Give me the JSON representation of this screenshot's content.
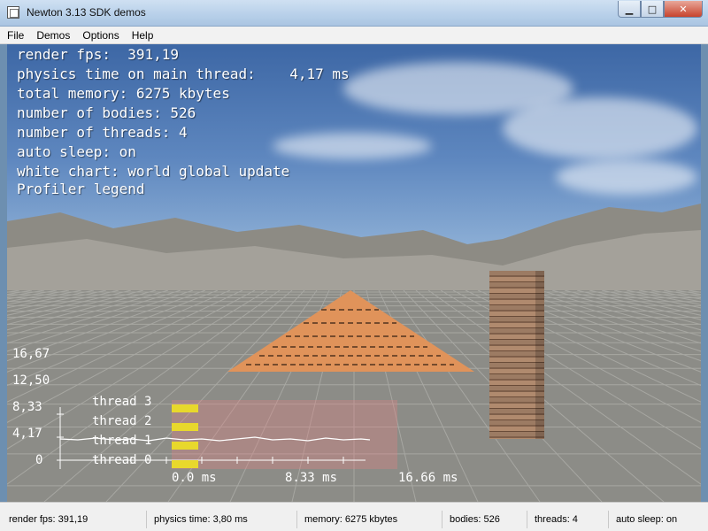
{
  "window": {
    "title": "Newton 3.13 SDK demos",
    "icons": {
      "app": "app-window-icon",
      "minimize": "minimize-icon",
      "maximize": "maximize-icon",
      "close": "close-icon"
    },
    "minimize_glyph": "▁",
    "maximize_glyph": "□",
    "close_glyph": "✕"
  },
  "menubar": {
    "items": [
      "File",
      "Demos",
      "Options",
      "Help"
    ]
  },
  "overlay": {
    "lines": [
      "render fps:  391,19",
      "physics time on main thread:    4,17 ms",
      "total memory: 6275 kbytes",
      "number of bodies: 526",
      "number of threads: 4",
      "auto sleep: on",
      "white chart: world global update",
      "Profiler legend"
    ]
  },
  "profiler": {
    "y_labels": [
      "16,67",
      "12,50",
      "8,33",
      "4,17",
      "0"
    ],
    "threads": [
      "thread 3",
      "thread 2",
      "thread 1",
      "thread 0"
    ],
    "x_labels": [
      "0.0 ms",
      "8.33 ms",
      "16.66 ms"
    ],
    "thread_color": "#e8d82c",
    "panel_color": "#e08080"
  },
  "statusbar": {
    "fps": "render fps: 391,19",
    "physics": "physics time: 3,80 ms",
    "memory": "memory: 6275 kbytes",
    "bodies": "bodies: 526",
    "threads": "threads: 4",
    "sleep": "auto sleep: on"
  },
  "colors": {
    "pyramid": "#e0935a",
    "tower": "#8c6a52",
    "ground": "#8c8c87"
  }
}
